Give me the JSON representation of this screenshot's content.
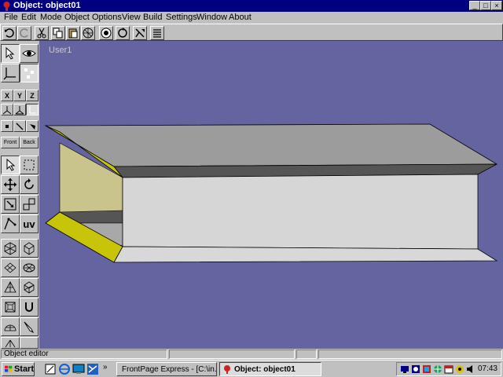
{
  "window": {
    "title": "Object: object01",
    "controls": {
      "minimize": "_",
      "maximize": "□",
      "close": "×"
    }
  },
  "menu": [
    "File",
    "Edit",
    "Mode",
    "Object",
    "Options",
    "View",
    "Build",
    "Settings",
    "Window",
    "About"
  ],
  "toolbar": {
    "icons": [
      "undo-icon",
      "redo-icon",
      "cut-icon",
      "copy-icon",
      "paste-icon",
      "grid-icon",
      "sphere-icon",
      "rotate-icon",
      "move-object-icon",
      "list-icon"
    ]
  },
  "leftpanel": {
    "axes": [
      "X",
      "Y",
      "Z"
    ],
    "view_buttons": [
      "Front",
      "Back"
    ],
    "uv_label": "uv"
  },
  "viewport": {
    "label": "User1",
    "background": "#6464a0"
  },
  "status": {
    "text": "Object editor"
  },
  "taskbar": {
    "start_label": "Start",
    "tasks": [
      {
        "label": "FrontPage Express - [C:\\in...",
        "active": false
      },
      {
        "label": "Object: object01",
        "active": true
      }
    ],
    "clock": "07:43"
  }
}
